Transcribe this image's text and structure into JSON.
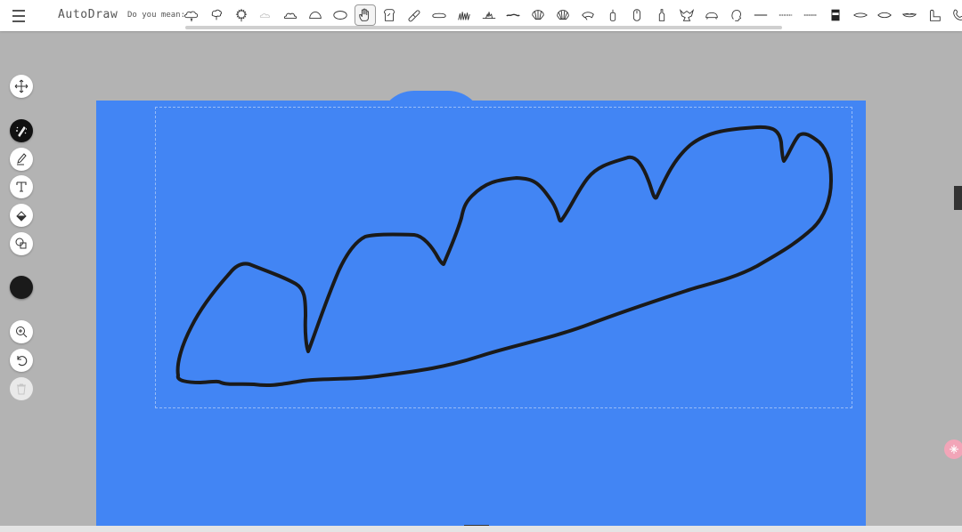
{
  "app": {
    "title": "AutoDraw"
  },
  "suggestions": {
    "label": "Do you mean:",
    "items": [
      {
        "icon": "cloud-icon"
      },
      {
        "icon": "tree-icon"
      },
      {
        "icon": "bush-icon"
      },
      {
        "icon": "small-cloud-icon"
      },
      {
        "icon": "cloud-outline-icon"
      },
      {
        "icon": "dome-icon"
      },
      {
        "icon": "oval-icon"
      },
      {
        "icon": "hand-icon",
        "selected": true
      },
      {
        "icon": "toast-icon"
      },
      {
        "icon": "bandage-icon"
      },
      {
        "icon": "bread-icon"
      },
      {
        "icon": "grass-icon"
      },
      {
        "icon": "flame-icon"
      },
      {
        "icon": "worm-icon"
      },
      {
        "icon": "shell-icon"
      },
      {
        "icon": "scallop-icon"
      },
      {
        "icon": "mushroom-icon"
      },
      {
        "icon": "lighter-icon"
      },
      {
        "icon": "mouse-icon"
      },
      {
        "icon": "bottle-icon"
      },
      {
        "icon": "dragon-icon"
      },
      {
        "icon": "turtle-icon"
      },
      {
        "icon": "face-icon"
      },
      {
        "icon": "line-icon"
      },
      {
        "icon": "dashed-line-icon"
      },
      {
        "icon": "dotted-line-icon"
      },
      {
        "icon": "mug-icon"
      },
      {
        "icon": "eye-icon"
      },
      {
        "icon": "eye-outline-icon"
      },
      {
        "icon": "lips-icon"
      },
      {
        "icon": "arm-icon"
      },
      {
        "icon": "phone-icon"
      }
    ]
  },
  "tools": [
    {
      "name": "move-tool",
      "icon": "move-icon"
    },
    {
      "name": "autodraw-tool",
      "icon": "autodraw-icon",
      "active": true
    },
    {
      "name": "draw-tool",
      "icon": "pencil-icon"
    },
    {
      "name": "type-tool",
      "icon": "text-icon"
    },
    {
      "name": "fill-tool",
      "icon": "fill-bucket-icon"
    },
    {
      "name": "shape-tool",
      "icon": "shapes-icon"
    },
    {
      "name": "color-tool",
      "icon": "color-swatch",
      "color": "#1a1a1a"
    },
    {
      "name": "zoom-tool",
      "icon": "zoom-in-icon"
    },
    {
      "name": "undo-tool",
      "icon": "undo-icon"
    },
    {
      "name": "delete-tool",
      "icon": "trash-icon",
      "disabled": true
    }
  ],
  "colors": {
    "canvas": "#4285f4",
    "stroke": "#1a1a1a",
    "workspace": "#b3b3b3",
    "toolbar": "#ffffff"
  }
}
